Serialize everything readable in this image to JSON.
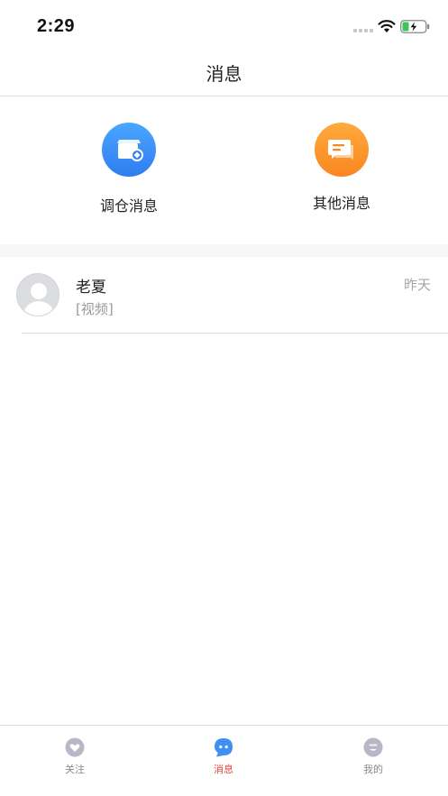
{
  "status_bar": {
    "time": "2:29",
    "icons": [
      "signal-icon",
      "wifi-icon",
      "battery-charging-icon"
    ]
  },
  "nav": {
    "title": "消息"
  },
  "categories": [
    {
      "label": "调仓消息",
      "icon": "warehouse-message-icon",
      "color": "#3b8ff8"
    },
    {
      "label": "其他消息",
      "icon": "chat-message-icon",
      "color": "#fb9a2d"
    }
  ],
  "conversations": [
    {
      "name": "老夏",
      "preview": "[视频]",
      "time": "昨天",
      "avatar": "default-avatar-icon"
    }
  ],
  "tab_bar": {
    "active_color": "#e8453c",
    "tabs": [
      {
        "label": "关注",
        "icon": "heart-badge-icon",
        "active": false
      },
      {
        "label": "消息",
        "icon": "message-bubble-icon",
        "active": true
      },
      {
        "label": "我的",
        "icon": "profile-face-icon",
        "active": false
      }
    ]
  }
}
